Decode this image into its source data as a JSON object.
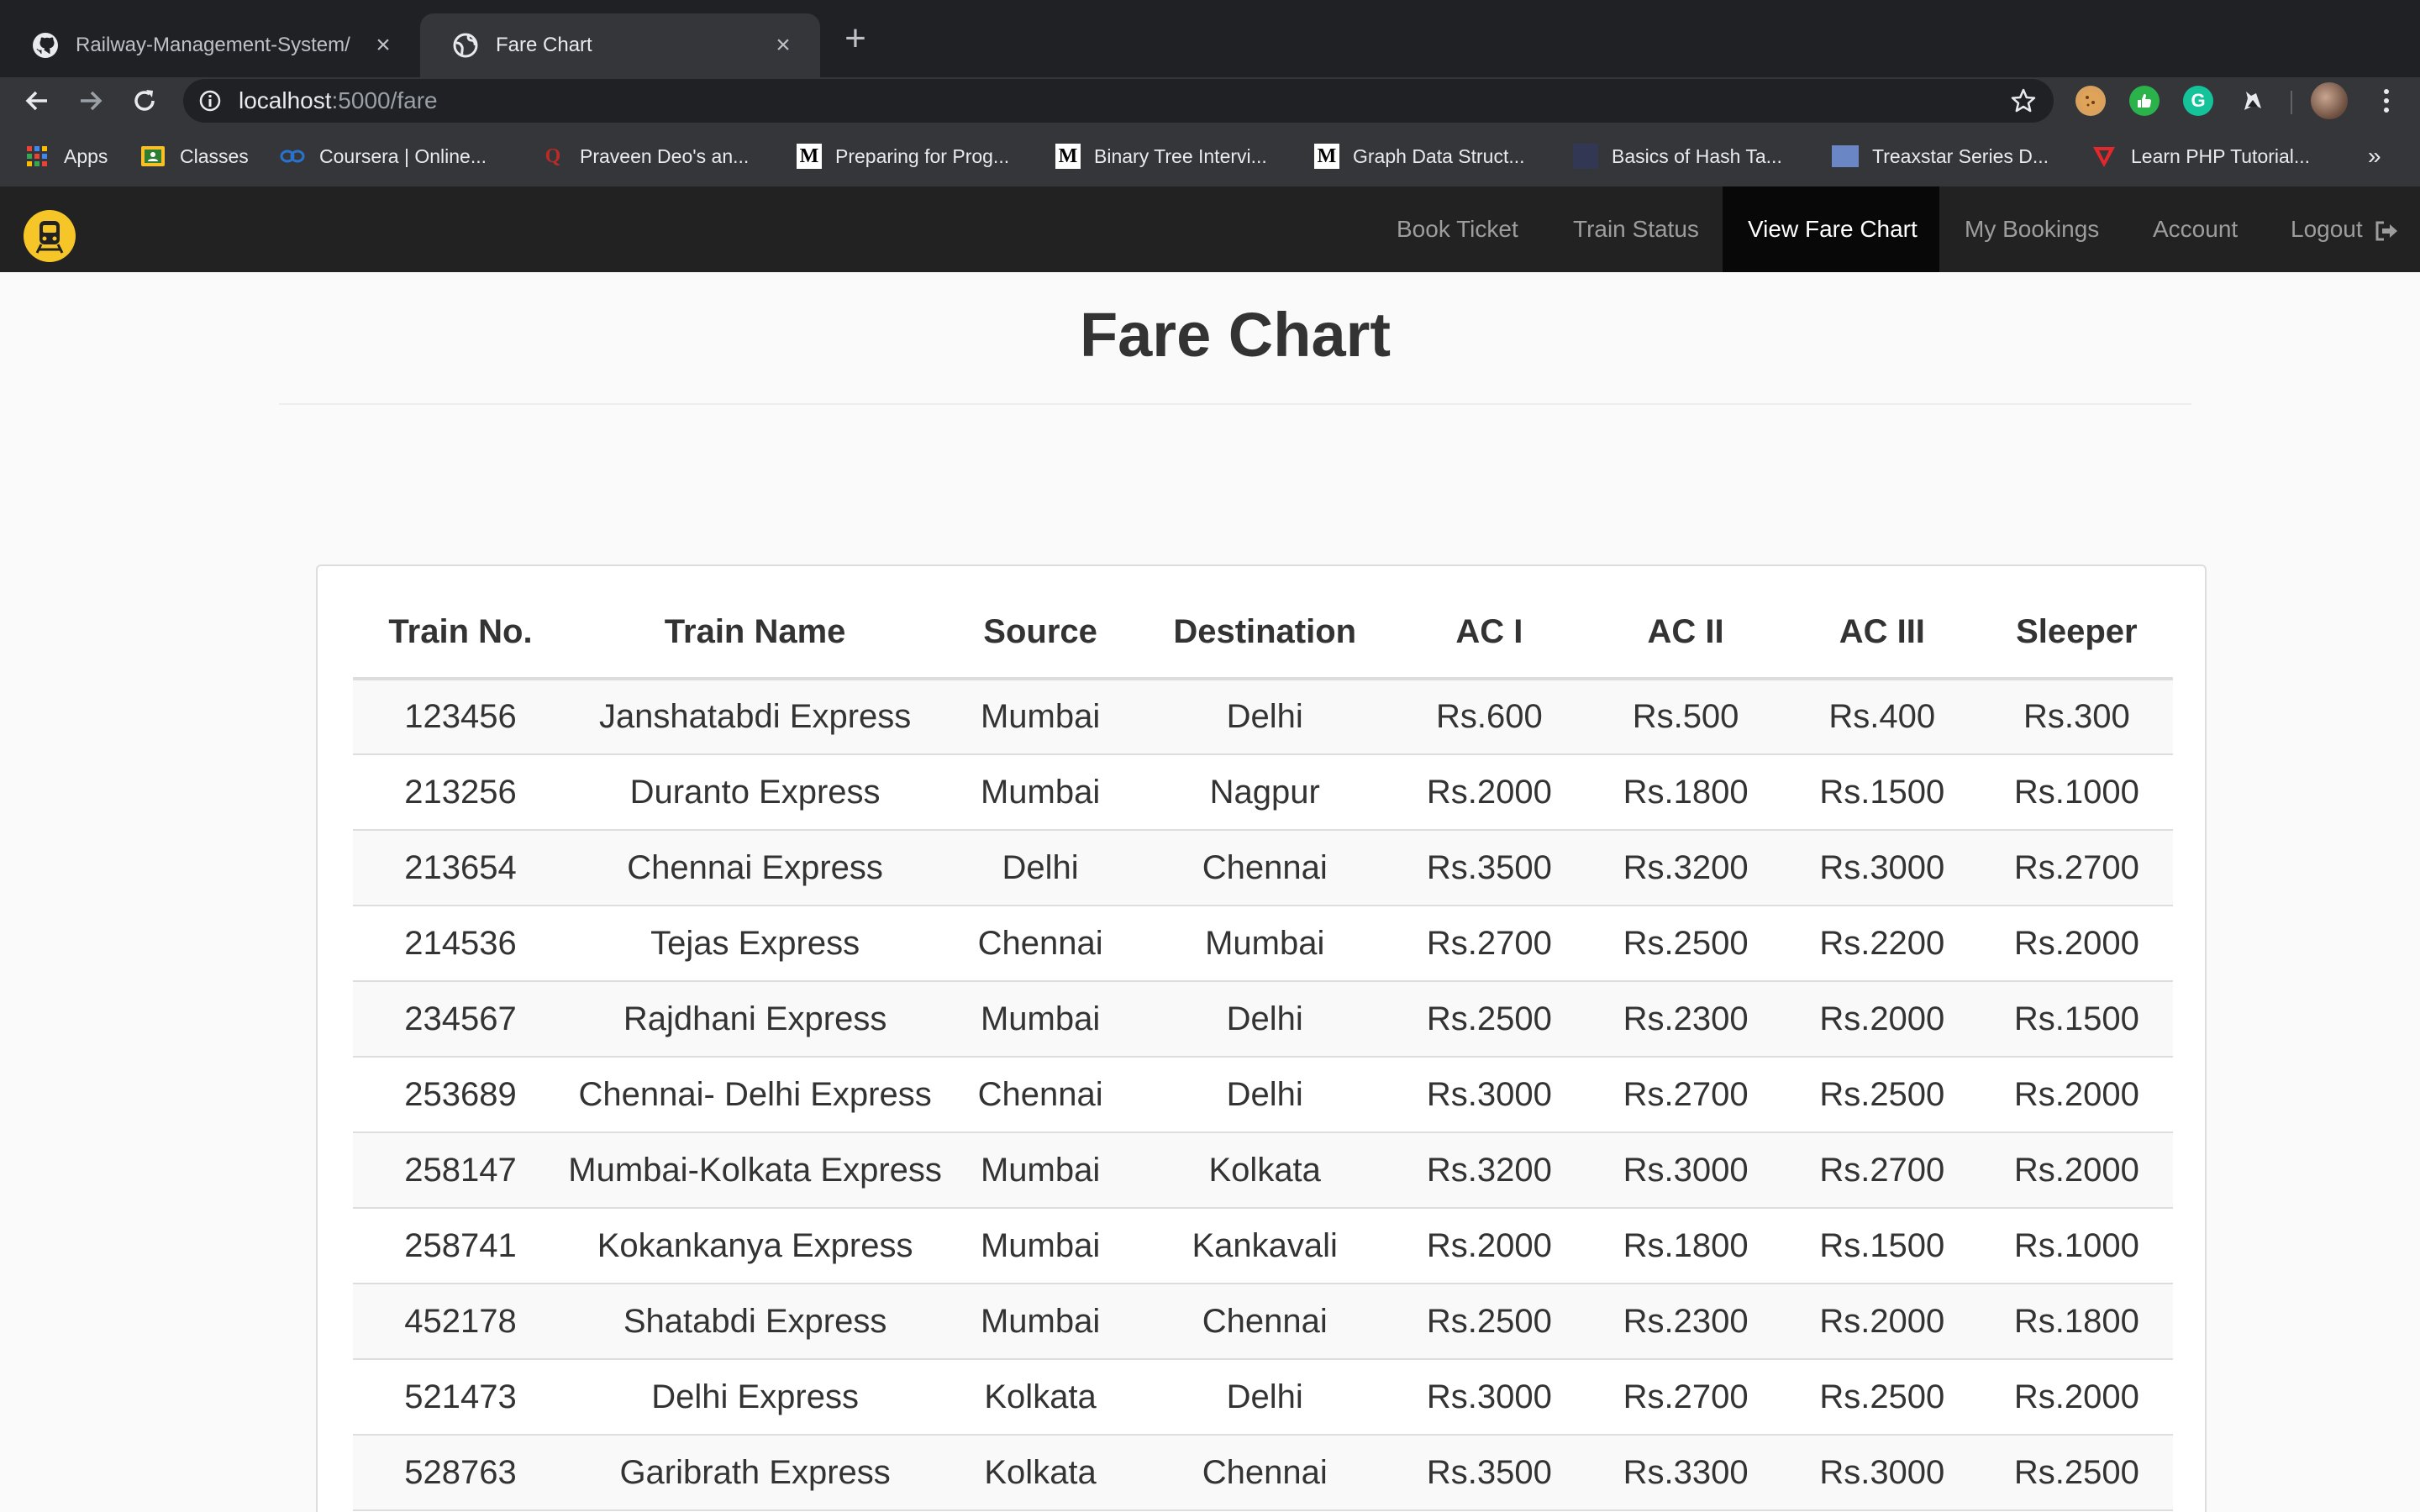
{
  "browser": {
    "tabs": [
      {
        "title": "Railway-Management-System/",
        "icon": "github-icon",
        "active": false
      },
      {
        "title": "Fare Chart",
        "icon": "globe-icon",
        "active": true
      }
    ],
    "url_host": "localhost",
    "url_path": ":5000/fare",
    "bookmarks": [
      {
        "label": "Apps",
        "icon": "apps-grid-icon"
      },
      {
        "label": "Classes",
        "icon": "classroom-icon"
      },
      {
        "label": "Coursera | Online...",
        "icon": "coursera-icon"
      },
      {
        "label": "Praveen Deo's an...",
        "icon": "quora-icon"
      },
      {
        "label": "Preparing for Prog...",
        "icon": "medium-icon"
      },
      {
        "label": "Binary Tree Intervi...",
        "icon": "medium-icon"
      },
      {
        "label": "Graph Data Struct...",
        "icon": "medium-icon"
      },
      {
        "label": "Basics of Hash Ta...",
        "icon": "hackerearth-icon"
      },
      {
        "label": "Treaxstar Series D...",
        "icon": "bookmark-image-icon"
      },
      {
        "label": "Learn PHP Tutorial...",
        "icon": "tutorial-v-icon"
      }
    ],
    "bookmarks_more": "»"
  },
  "navbar": {
    "links": [
      {
        "label": "Book Ticket",
        "active": false
      },
      {
        "label": "Train Status",
        "active": false
      },
      {
        "label": "View Fare Chart",
        "active": true
      },
      {
        "label": "My Bookings",
        "active": false
      },
      {
        "label": "Account",
        "active": false
      },
      {
        "label": "Logout",
        "active": false
      }
    ]
  },
  "page": {
    "title": "Fare Chart"
  },
  "fare_table": {
    "columns": [
      "Train No.",
      "Train Name",
      "Source",
      "Destination",
      "AC I",
      "AC II",
      "AC III",
      "Sleeper"
    ],
    "rows": [
      [
        "123456",
        "Janshatabdi Express",
        "Mumbai",
        "Delhi",
        "Rs.600",
        "Rs.500",
        "Rs.400",
        "Rs.300"
      ],
      [
        "213256",
        "Duranto Express",
        "Mumbai",
        "Nagpur",
        "Rs.2000",
        "Rs.1800",
        "Rs.1500",
        "Rs.1000"
      ],
      [
        "213654",
        "Chennai Express",
        "Delhi",
        "Chennai",
        "Rs.3500",
        "Rs.3200",
        "Rs.3000",
        "Rs.2700"
      ],
      [
        "214536",
        "Tejas Express",
        "Chennai",
        "Mumbai",
        "Rs.2700",
        "Rs.2500",
        "Rs.2200",
        "Rs.2000"
      ],
      [
        "234567",
        "Rajdhani Express",
        "Mumbai",
        "Delhi",
        "Rs.2500",
        "Rs.2300",
        "Rs.2000",
        "Rs.1500"
      ],
      [
        "253689",
        "Chennai- Delhi Express",
        "Chennai",
        "Delhi",
        "Rs.3000",
        "Rs.2700",
        "Rs.2500",
        "Rs.2000"
      ],
      [
        "258147",
        "Mumbai-Kolkata Express",
        "Mumbai",
        "Kolkata",
        "Rs.3200",
        "Rs.3000",
        "Rs.2700",
        "Rs.2000"
      ],
      [
        "258741",
        "Kokankanya Express",
        "Mumbai",
        "Kankavali",
        "Rs.2000",
        "Rs.1800",
        "Rs.1500",
        "Rs.1000"
      ],
      [
        "452178",
        "Shatabdi Express",
        "Mumbai",
        "Chennai",
        "Rs.2500",
        "Rs.2300",
        "Rs.2000",
        "Rs.1800"
      ],
      [
        "521473",
        "Delhi Express",
        "Kolkata",
        "Delhi",
        "Rs.3000",
        "Rs.2700",
        "Rs.2500",
        "Rs.2000"
      ],
      [
        "528763",
        "Garibrath Express",
        "Kolkata",
        "Chennai",
        "Rs.3500",
        "Rs.3300",
        "Rs.3000",
        "Rs.2500"
      ]
    ]
  }
}
